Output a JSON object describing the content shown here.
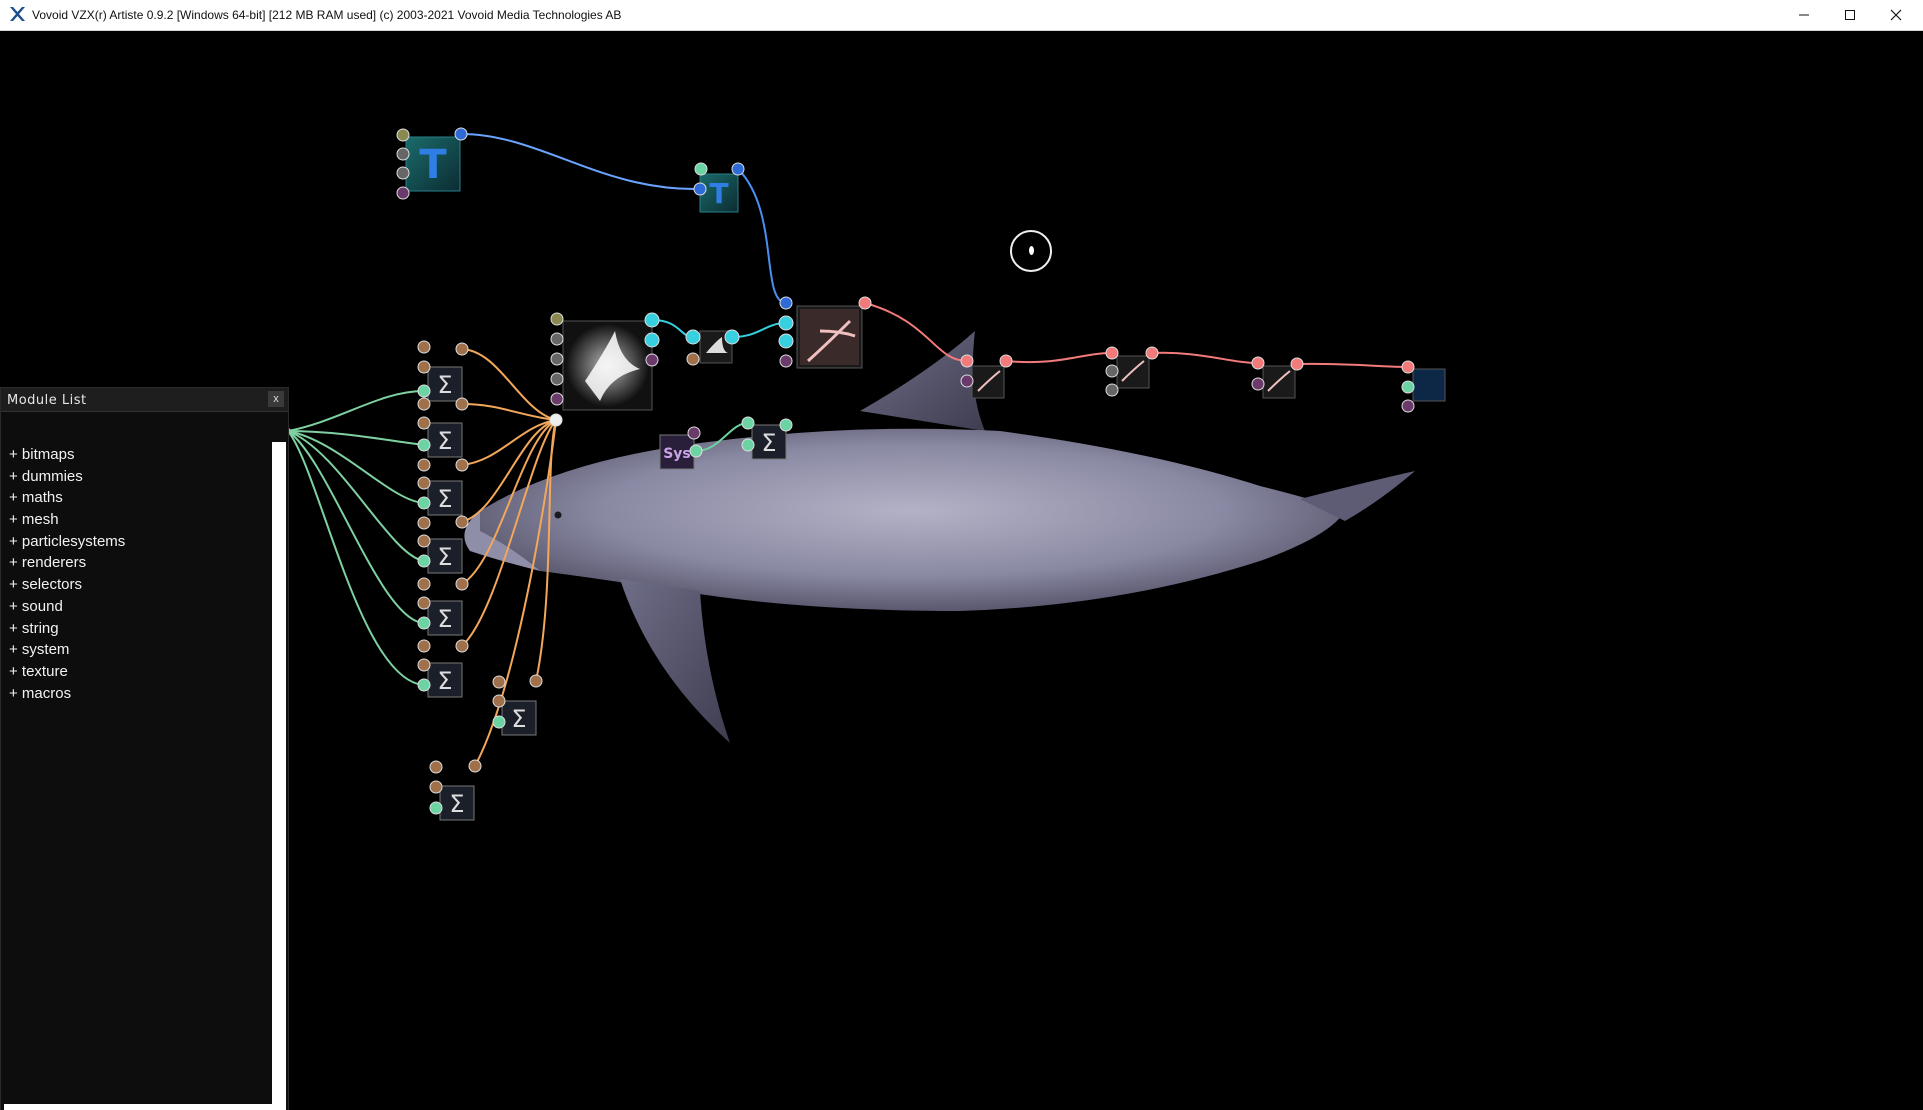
{
  "window": {
    "title": "Vovoid VZX(r) Artiste 0.9.2 [Windows 64-bit] [212 MB RAM used] (c) 2003-2021 Vovoid Media Technologies AB",
    "app_icon": "vzx-x-logo-icon",
    "controls": [
      "minimize-icon",
      "maximize-icon",
      "close-icon"
    ]
  },
  "module_list": {
    "title": "Module List",
    "close_label": "x",
    "items": [
      {
        "label": "+ bitmaps"
      },
      {
        "label": "+ dummies"
      },
      {
        "label": "+ maths"
      },
      {
        "label": "+ mesh"
      },
      {
        "label": "+ particlesystems"
      },
      {
        "label": "+ renderers"
      },
      {
        "label": "+ selectors"
      },
      {
        "label": "+ sound"
      },
      {
        "label": "+ string"
      },
      {
        "label": "+ system"
      },
      {
        "label": "+ texture"
      },
      {
        "label": "+ macros"
      }
    ]
  },
  "canvas": {
    "background": "#000000",
    "wire_colors": {
      "text": "#5aa0ff",
      "float": "#f2a75a",
      "render": "#f27a7a",
      "particle": "#37d0e0",
      "sequence": "#6cd3a2"
    },
    "node_icons": [
      "text-module-icon",
      "sum-module-icon",
      "particle-module-icon",
      "render-module-icon",
      "sys-module-icon",
      "screen-module-icon"
    ],
    "preview_subject": "dolphin-image"
  }
}
